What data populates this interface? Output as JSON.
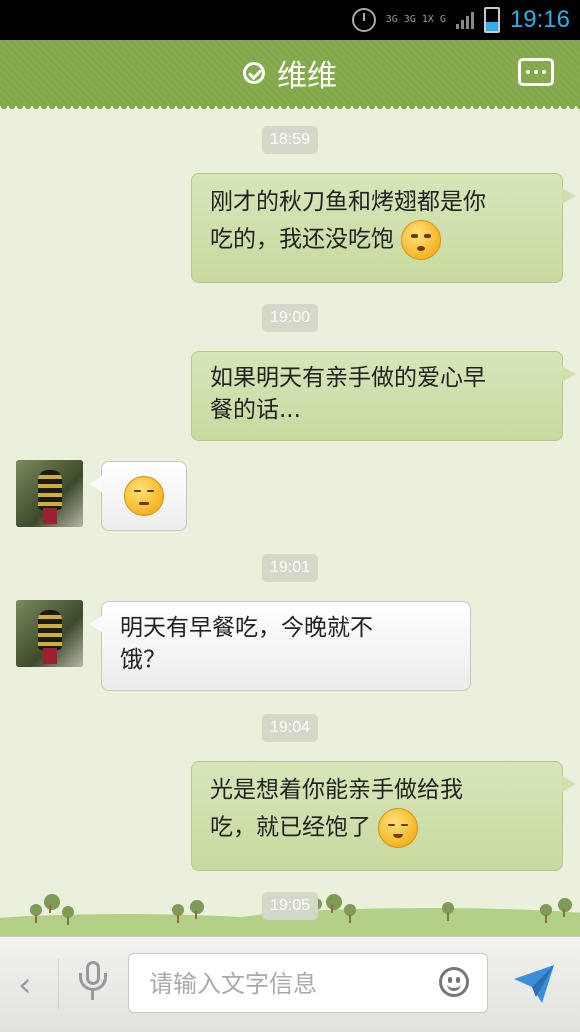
{
  "status_bar": {
    "network_top": "3G 3G 1X G",
    "time": "19:16"
  },
  "header": {
    "title": "维维"
  },
  "messages": [
    {
      "type": "time",
      "text": "18:59"
    },
    {
      "type": "outgoing",
      "line1": "刚才的秋刀鱼和烤翅都是你",
      "line2": "吃的，我还没吃饱",
      "emoji": "pleading-emoji"
    },
    {
      "type": "time",
      "text": "19:00"
    },
    {
      "type": "outgoing",
      "line1": "如果明天有亲手做的爱心早",
      "line2": "餐的话..."
    },
    {
      "type": "incoming",
      "emoji": "smug-emoji"
    },
    {
      "type": "time",
      "text": "19:01"
    },
    {
      "type": "incoming",
      "line1": "明天有早餐吃，今晚就不",
      "line2": "饿？"
    },
    {
      "type": "time",
      "text": "19:04"
    },
    {
      "type": "outgoing",
      "line1": "光是想着你能亲手做给我",
      "line2": "吃，就已经饱了",
      "emoji": "content-emoji"
    },
    {
      "type": "time",
      "text": "19:05"
    }
  ],
  "input": {
    "placeholder": "请输入文字信息"
  }
}
